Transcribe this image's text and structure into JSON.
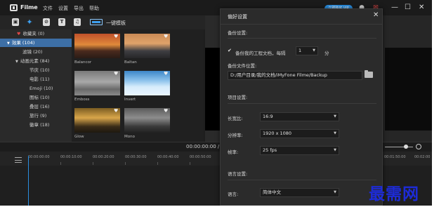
{
  "titlebar": {
    "app_name": "Filme",
    "menus": [
      "文件",
      "设置",
      "导出",
      "帮助"
    ],
    "upgrade": "立即购买 VIP",
    "window_controls": [
      "—",
      "☐",
      "✕"
    ]
  },
  "toolbar": {
    "one_click_template": "一键模板"
  },
  "sidebar": {
    "items": [
      {
        "label": "收藏夹 (0)"
      },
      {
        "label": "效果 (104)"
      },
      {
        "label": "滤镜 (20)"
      },
      {
        "label": "动画元素 (84)"
      },
      {
        "label": "节庆 (10)"
      },
      {
        "label": "电影 (11)"
      },
      {
        "label": "Emoji (10)"
      },
      {
        "label": "图标 (10)"
      },
      {
        "label": "叠层 (16)"
      },
      {
        "label": "旅行 (9)"
      },
      {
        "label": "徽章 (18)"
      }
    ]
  },
  "thumbnails": [
    {
      "label": "Balancor"
    },
    {
      "label": "Baltan"
    },
    {
      "label": "Emboss"
    },
    {
      "label": "Invert"
    },
    {
      "label": "Glow"
    },
    {
      "label": "Mono"
    }
  ],
  "timeline": {
    "timecode": "00:00:00:00 /",
    "ruler": [
      "00:00:00:00",
      "00:00:10:00",
      "00:00:20:00",
      "00:00:30:00",
      "00:00:40:00",
      "00:00:50:00",
      "00:01:00:00",
      "00:01:10:00"
    ],
    "ruler_right": [
      "00:01:50:00",
      "00:02:00"
    ]
  },
  "dialog": {
    "title": "偏好设置",
    "backup_section": "备份设置:",
    "backup_check_label": "备份我的工程文档，每隔",
    "backup_interval": "1",
    "backup_unit": "分",
    "backup_location_label": "备份文件位置:",
    "backup_path": "D:/用户目录/我的文档/iMyFone Filme/Backup",
    "project_section": "项目设置:",
    "aspect_label": "长宽比:",
    "aspect_value": "16:9",
    "resolution_label": "分辨率:",
    "resolution_value": "1920 x 1080",
    "framerate_label": "帧率:",
    "framerate_value": "25 fps",
    "language_section": "语言设置:",
    "language_label": "语言:",
    "language_value": "简体中文"
  },
  "watermark": "最需网"
}
